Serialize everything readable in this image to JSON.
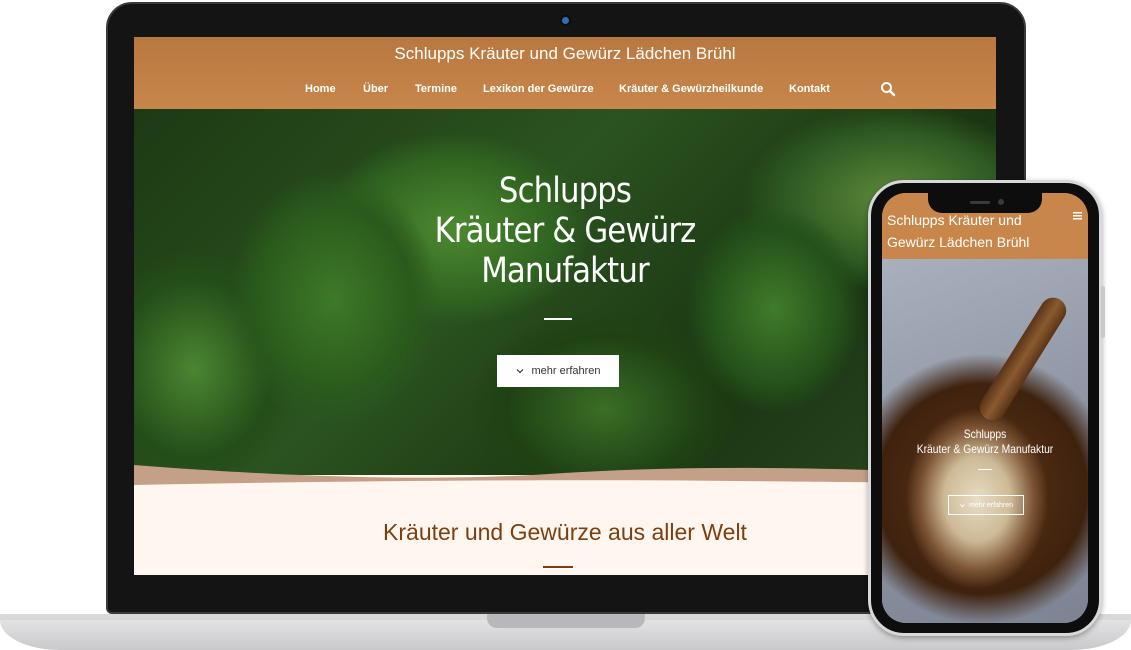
{
  "desktop": {
    "site_title": "Schlupps Kräuter und Gewürz Lädchen Brühl",
    "nav": [
      {
        "label": "Home"
      },
      {
        "label": "Über"
      },
      {
        "label": "Termine"
      },
      {
        "label": "Lexikon der Gewürze"
      },
      {
        "label": "Kräuter & Gewürzheilkunde"
      },
      {
        "label": "Kontakt"
      }
    ],
    "search_icon": "search-icon",
    "hero": {
      "title_lines": [
        "Schlupps",
        "Kräuter & Gewürz",
        "Manufaktur"
      ],
      "button_label": "mehr erfahren",
      "button_icon": "chevron-down-icon"
    },
    "section_title": "Kräuter und Gewürze aus aller Welt"
  },
  "mobile": {
    "site_title": "Schlupps Kräuter und Gewürz Lädchen Brühl",
    "menu_icon": "hamburger-icon",
    "hero": {
      "title_lines": [
        "Schlupps",
        "Kräuter & Gewürz Manufaktur"
      ],
      "button_label": "mehr erfahren",
      "button_icon": "chevron-down-icon"
    }
  },
  "colors": {
    "header_brown": "#c8864a",
    "heading_brown": "#7a4012",
    "section_bg": "#fff7ef",
    "wave_tan": "#c4a088"
  }
}
